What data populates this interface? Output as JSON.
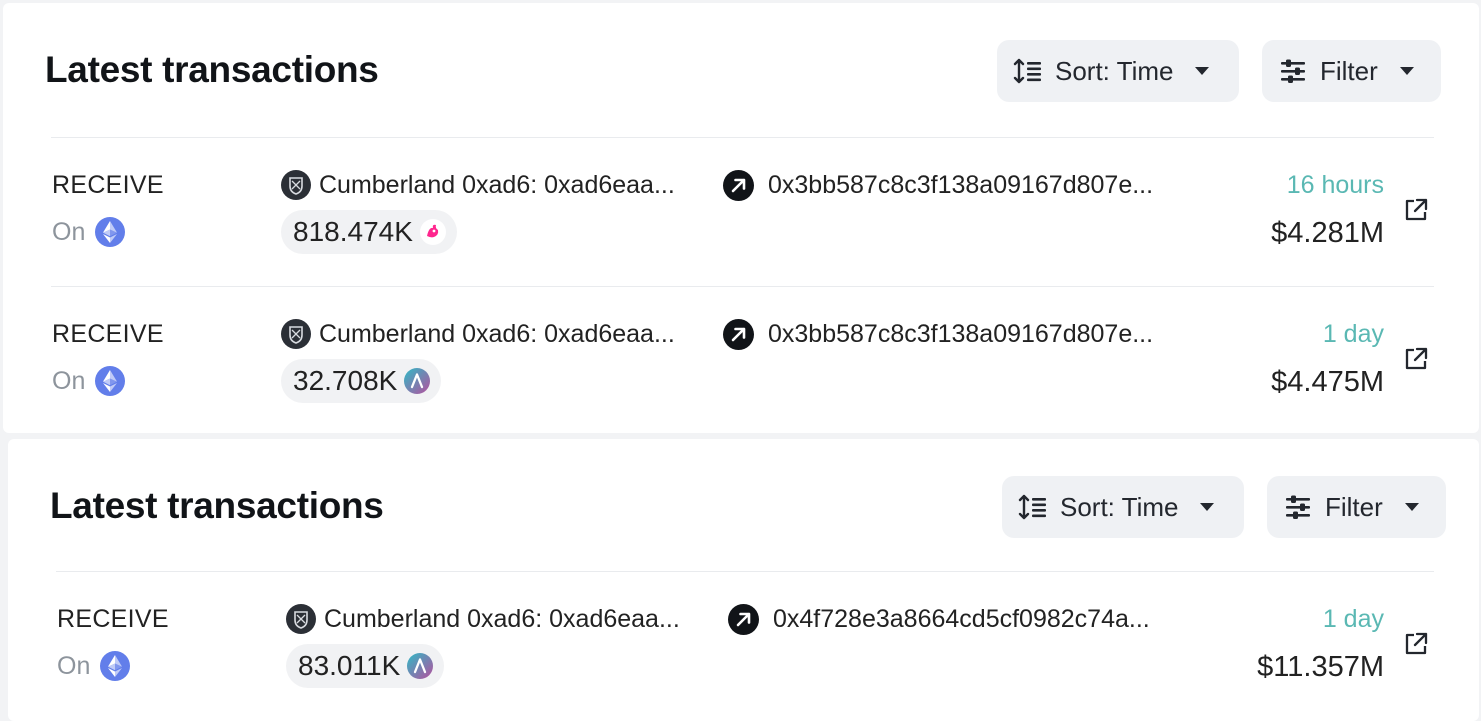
{
  "sections": [
    {
      "title": "Latest transactions",
      "sort_label": "Sort: Time",
      "filter_label": "Filter",
      "rows": [
        {
          "type": "RECEIVE",
          "on_label": "On",
          "from": "Cumberland 0xad6: 0xad6eaa...",
          "to": "0x3bb587c8c3f138a09167d807e...",
          "amount": "818.474K",
          "token_icon": "uni-icon",
          "time": "16 hours",
          "usd": "$4.281M"
        },
        {
          "type": "RECEIVE",
          "on_label": "On",
          "from": "Cumberland 0xad6: 0xad6eaa...",
          "to": "0x3bb587c8c3f138a09167d807e...",
          "amount": "32.708K",
          "token_icon": "aave-icon",
          "time": "1 day",
          "usd": "$4.475M"
        }
      ]
    },
    {
      "title": "Latest transactions",
      "sort_label": "Sort: Time",
      "filter_label": "Filter",
      "rows": [
        {
          "type": "RECEIVE",
          "on_label": "On",
          "from": "Cumberland 0xad6: 0xad6eaa...",
          "to": "0x4f728e3a8664cd5cf0982c74a...",
          "amount": "83.011K",
          "token_icon": "aave-icon",
          "time": "1 day",
          "usd": "$11.357M"
        }
      ]
    }
  ],
  "colors": {
    "time": "#5ab8b3",
    "button_bg": "#eff1f4",
    "eth": "#627eea"
  },
  "icons": {
    "sort": "sort-icon",
    "filter": "filter-sliders-icon",
    "chain": "ethereum-icon",
    "entity": "cumberland-shield-icon",
    "arrow": "arrow-up-right-icon",
    "link": "external-link-icon"
  }
}
